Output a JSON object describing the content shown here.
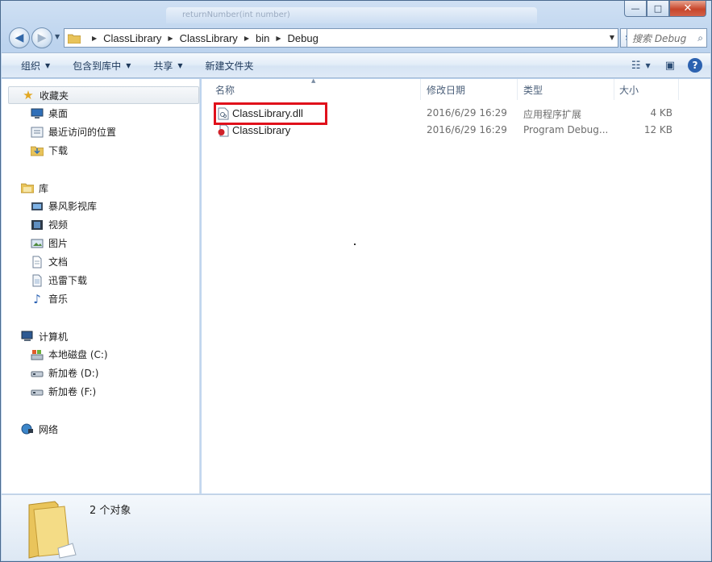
{
  "titlebar": {
    "faint_text": "returnNumber(int number)",
    "minimize": "—",
    "maximize": "□",
    "close": "✕"
  },
  "address": {
    "breadcrumbs": [
      "ClassLibrary",
      "ClassLibrary",
      "bin",
      "Debug"
    ],
    "search_placeholder": "搜索 Debug"
  },
  "toolbar": {
    "organize": "组织",
    "include_in_library": "包含到库中",
    "share": "共享",
    "new_folder": "新建文件夹"
  },
  "nav": {
    "favorites": {
      "label": "收藏夹",
      "items": [
        {
          "label": "桌面",
          "icon": "desktop-icon"
        },
        {
          "label": "最近访问的位置",
          "icon": "recent-places-icon"
        },
        {
          "label": "下载",
          "icon": "downloads-icon"
        }
      ]
    },
    "libraries": {
      "label": "库",
      "items": [
        {
          "label": "暴风影视库",
          "icon": "video-library-icon"
        },
        {
          "label": "视频",
          "icon": "videos-icon"
        },
        {
          "label": "图片",
          "icon": "pictures-icon"
        },
        {
          "label": "文档",
          "icon": "documents-icon"
        },
        {
          "label": "迅雷下载",
          "icon": "thunder-download-icon"
        },
        {
          "label": "音乐",
          "icon": "music-icon"
        }
      ]
    },
    "computer": {
      "label": "计算机",
      "items": [
        {
          "label": "本地磁盘 (C:)",
          "icon": "system-drive-icon"
        },
        {
          "label": "新加卷 (D:)",
          "icon": "drive-icon"
        },
        {
          "label": "新加卷 (F:)",
          "icon": "drive-icon"
        }
      ]
    },
    "network": {
      "label": "网络"
    }
  },
  "columns": {
    "name": "名称",
    "date": "修改日期",
    "type": "类型",
    "size": "大小"
  },
  "files": [
    {
      "name": "ClassLibrary.dll",
      "date": "2016/6/29 16:29",
      "type": "应用程序扩展",
      "size": "4 KB",
      "icon": "dll-file-icon"
    },
    {
      "name": "ClassLibrary",
      "date": "2016/6/29 16:29",
      "type": "Program Debug...",
      "size": "12 KB",
      "icon": "pdb-file-icon"
    }
  ],
  "details": {
    "count": "2 个对象"
  },
  "colors": {
    "highlight": "#e0101b",
    "window_frame": "#bcd3ee"
  }
}
